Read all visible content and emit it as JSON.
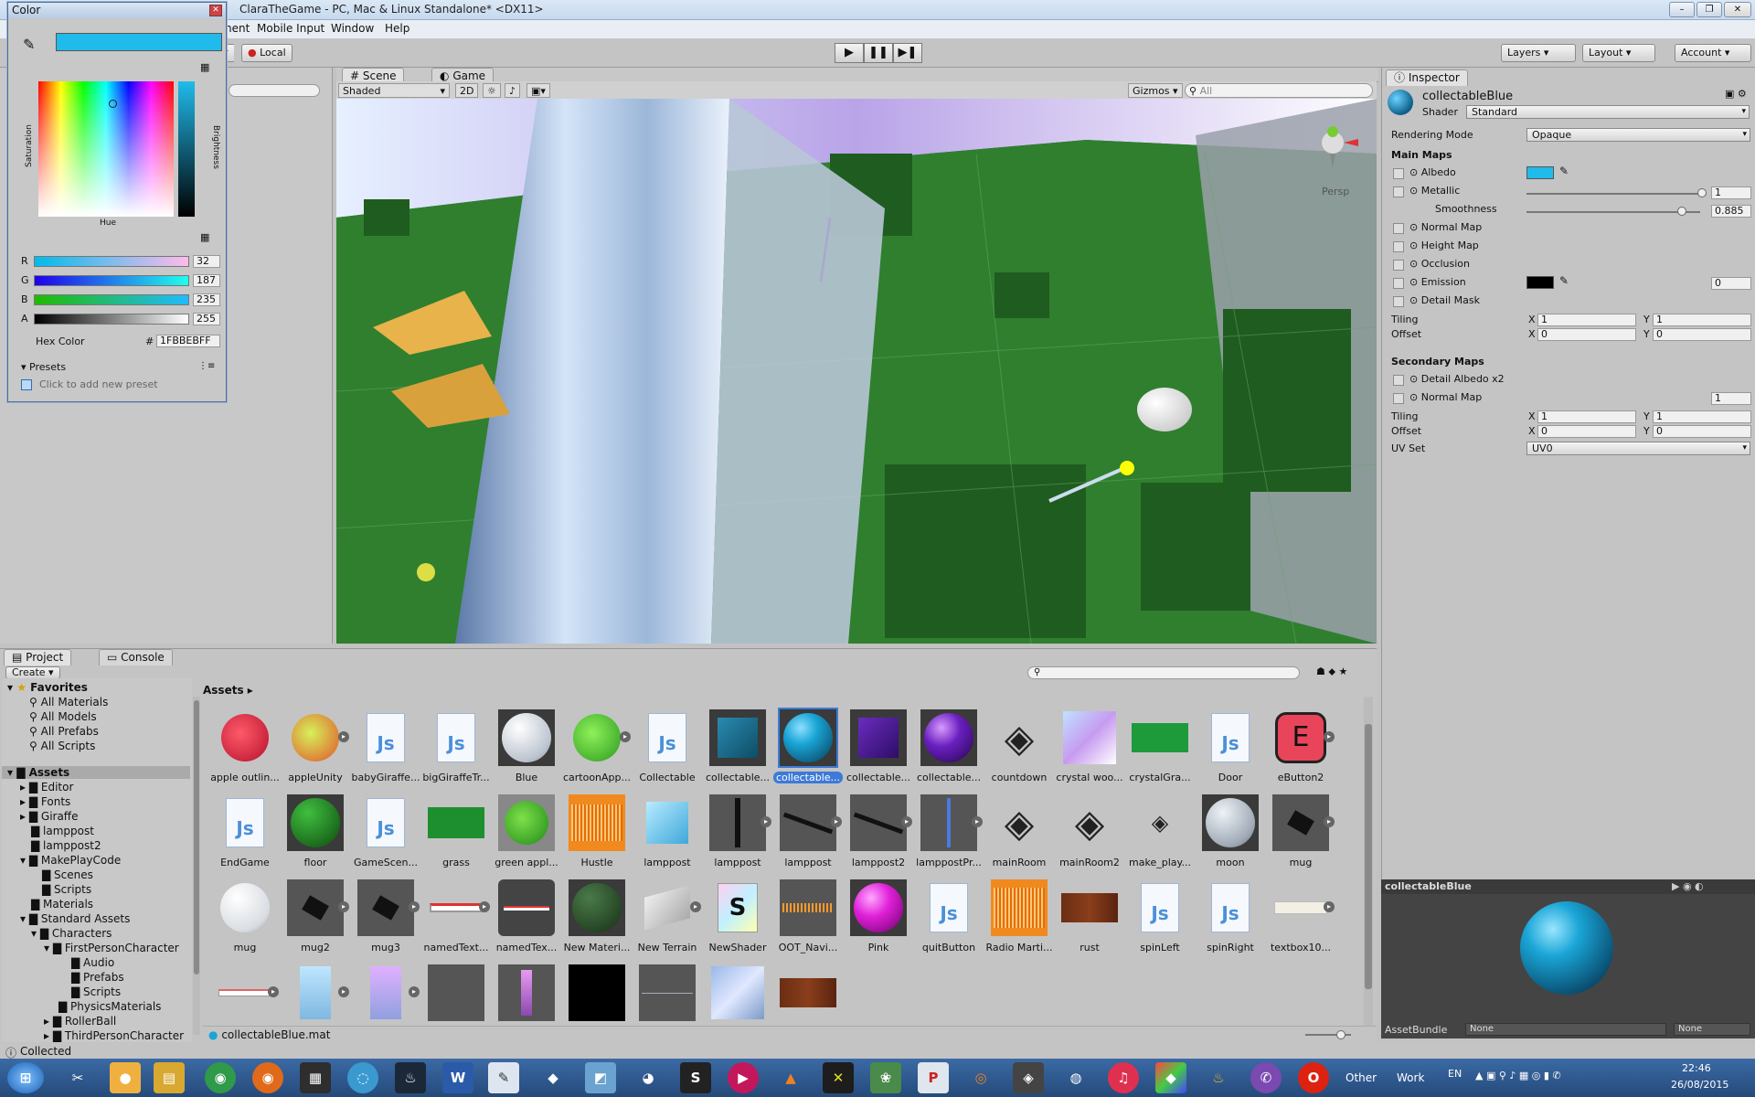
{
  "window": {
    "title": "ClaraTheGame - PC, Mac & Linux Standalone* <DX11>"
  },
  "menu": [
    "nent",
    "Mobile Input",
    "Window",
    "Help"
  ],
  "toolbar": {
    "pivot_suffix": "r",
    "local": "Local",
    "layers": "Layers",
    "layout": "Layout",
    "account": "Account"
  },
  "scene": {
    "tab_scene": "Scene",
    "tab_game": "Game",
    "shading": "Shaded",
    "mode2d": "2D",
    "gizmos": "Gizmos",
    "search_placeholder": "All",
    "persp": "Persp"
  },
  "inspector": {
    "tab": "Inspector",
    "object_name": "collectableBlue",
    "shader_label": "Shader",
    "shader_value": "Standard",
    "rendering_mode_label": "Rendering Mode",
    "rendering_mode_value": "Opaque",
    "main_maps": "Main Maps",
    "albedo": "Albedo",
    "albedo_color": "#20BBEB",
    "metallic": "Metallic",
    "metallic_value": "1",
    "smoothness": "Smoothness",
    "smoothness_value": "0.885",
    "normal_map": "Normal Map",
    "height_map": "Height Map",
    "occlusion": "Occlusion",
    "emission": "Emission",
    "emission_value": "0",
    "detail_mask": "Detail Mask",
    "tiling": "Tiling",
    "offset": "Offset",
    "x": "X",
    "y": "Y",
    "main_tiling_x": "1",
    "main_tiling_y": "1",
    "main_offset_x": "0",
    "main_offset_y": "0",
    "secondary_maps": "Secondary Maps",
    "detail_albedo": "Detail Albedo x2",
    "sec_normal_map": "Normal Map",
    "sec_normal_value": "1",
    "sec_tiling_x": "1",
    "sec_tiling_y": "1",
    "sec_offset_x": "0",
    "sec_offset_y": "0",
    "uv_set": "UV Set",
    "uv_set_value": "UV0"
  },
  "preview": {
    "title": "collectableBlue",
    "assetbundle": "AssetBundle",
    "ab_value": "None",
    "ab_variant": "None"
  },
  "colorpicker": {
    "title": "Color",
    "saturation": "Saturation",
    "brightness": "Brightness",
    "hue": "Hue",
    "r_label": "R",
    "r": "32",
    "g_label": "G",
    "g": "187",
    "b_label": "B",
    "b": "235",
    "a_label": "A",
    "a": "255",
    "hex_label": "Hex Color",
    "hex_hash": "#",
    "hex": "1FBBEBFF",
    "presets": "Presets",
    "add_preset": "Click to add new preset"
  },
  "project": {
    "tab_project": "Project",
    "tab_console": "Console",
    "create": "Create",
    "breadcrumb": "Assets",
    "favorites": "Favorites",
    "fav_items": [
      "All Materials",
      "All Models",
      "All Prefabs",
      "All Scripts"
    ],
    "assets_root": "Assets",
    "tree": [
      "Editor",
      "Fonts",
      "Giraffe",
      "lamppost",
      "lamppost2",
      "MakePlayCode",
      "Scenes",
      "Scripts",
      "Materials",
      "Standard Assets",
      "Characters",
      "FirstPersonCharacter",
      "Audio",
      "Prefabs",
      "Scripts",
      "PhysicsMaterials",
      "RollerBall",
      "ThirdPersonCharacter"
    ],
    "row1": [
      "apple outlin...",
      "appleUnity",
      "babyGiraffe...",
      "bigGiraffeTr...",
      "Blue",
      "cartoonApp...",
      "Collectable",
      "collectable...",
      "collectable...",
      "collectable...",
      "collectable...",
      "countdown",
      "crystal woo...",
      "crystalGra...",
      "Door",
      "eButton2"
    ],
    "row2": [
      "EndGame",
      "floor",
      "GameScen...",
      "grass",
      "green appl...",
      "Hustle",
      "lamppost",
      "lamppost",
      "lamppost",
      "lamppost2",
      "lamppostPr...",
      "mainRoom",
      "mainRoom2",
      "make_play...",
      "moon",
      "mug"
    ],
    "row3": [
      "mug",
      "mug2",
      "mug3",
      "namedText...",
      "namedTex...",
      "New Materi...",
      "New Terrain",
      "NewShader",
      "OOT_Navi...",
      "Pink",
      "quitButton",
      "Radio Marti...",
      "rust",
      "spinLeft",
      "spinRight",
      "textbox10..."
    ],
    "js_letters": "Js",
    "shader_letter": "S",
    "ebutton_letter": "E",
    "selected_path": "collectableBlue.mat"
  },
  "status": {
    "text": "Collected"
  },
  "taskbar": {
    "other": "Other",
    "work": "Work",
    "lang": "EN",
    "time": "22:46",
    "date": "26/08/2015"
  }
}
